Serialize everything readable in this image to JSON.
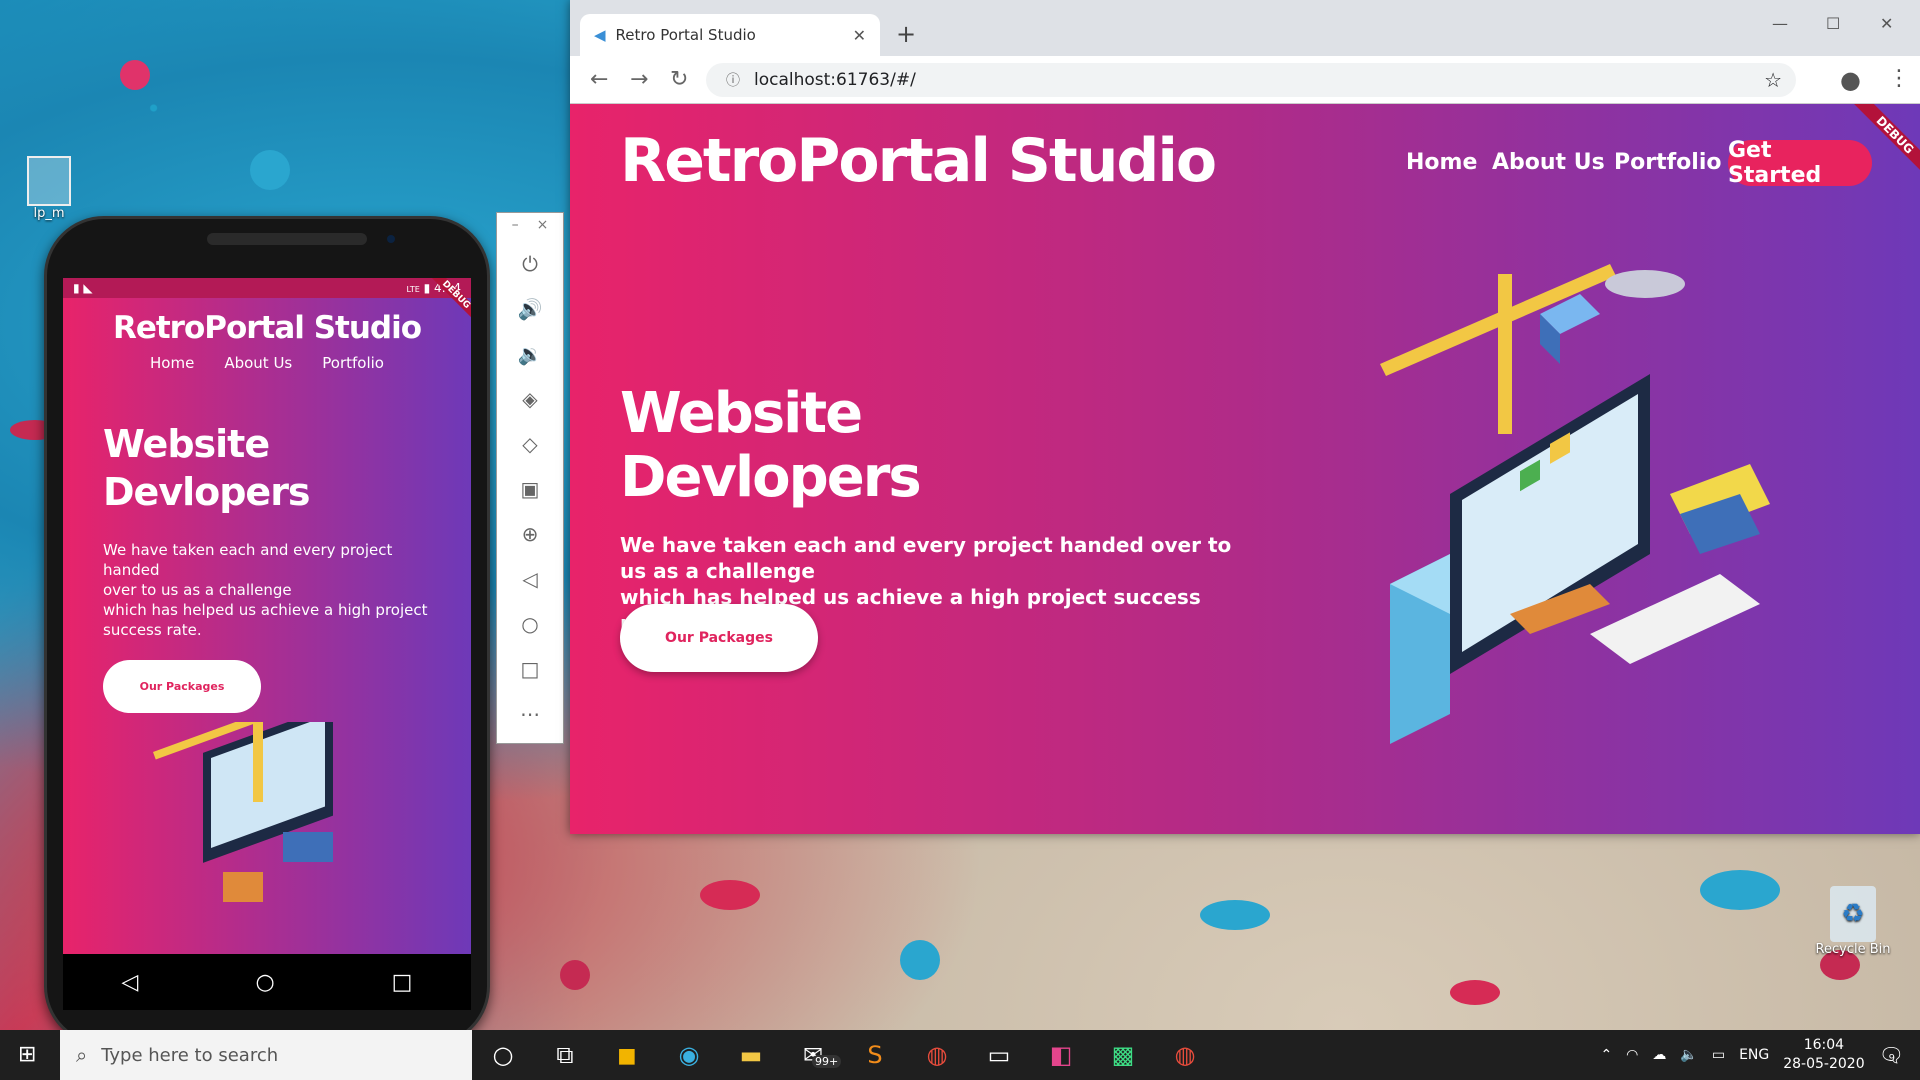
{
  "desktop": {
    "icon1_label": "lp_m",
    "recycle_label": "Recycle Bin"
  },
  "phone": {
    "status_time": "4:04",
    "status_network": "LTE",
    "debug": "DEBUG",
    "title": "RetroPortal Studio",
    "nav": [
      "Home",
      "About Us",
      "Portfolio"
    ],
    "heading_line1": "Website",
    "heading_line2": "Devlopers",
    "subtitle_line1": "We have taken each and every project handed",
    "subtitle_line2": "over to us as a challenge",
    "subtitle_line3": "which has helped us achieve a high project",
    "subtitle_line4": "success rate.",
    "button": "Our Packages"
  },
  "emulator": {
    "icons": [
      "minimize-icon",
      "close-icon",
      "power-icon",
      "volume-up-icon",
      "volume-down-icon",
      "rotate-left-icon",
      "rotate-right-icon",
      "camera-icon",
      "zoom-icon",
      "back-icon",
      "home-icon",
      "overview-icon",
      "more-icon"
    ]
  },
  "browser": {
    "tab_title": "Retro Portal Studio",
    "url": "localhost:61763/#/",
    "debug": "DEBUG"
  },
  "site": {
    "brand": "RetroPortal Studio",
    "menu": [
      "Home",
      "About Us",
      "Portfolio"
    ],
    "cta": "Get Started",
    "heading_line1": "Website",
    "heading_line2": "Devlopers",
    "subtitle_line1": "We have taken each and every project handed over to us as a challenge",
    "subtitle_line2": "which has helped us achieve a high project success rate.",
    "button": "Our Packages",
    "colors": {
      "gradient_start": "#e8236a",
      "gradient_end": "#6e39b8",
      "cta": "#e8235e"
    }
  },
  "taskbar": {
    "search_placeholder": "Type here to search",
    "mail_badge": "99+",
    "lang": "ENG",
    "time": "16:04",
    "date": "28-05-2020",
    "notif_count": "9"
  }
}
